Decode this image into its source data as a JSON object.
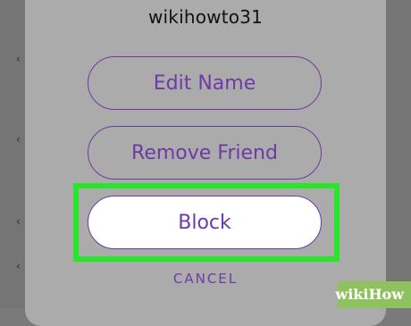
{
  "dialog": {
    "title": "wikihowto31",
    "buttons": {
      "edit_name": "Edit Name",
      "remove_friend": "Remove Friend",
      "block": "Block"
    },
    "cancel_label": "CANCEL"
  },
  "colors": {
    "accent": "#6d3aa6",
    "highlight": "#2ae62a",
    "sheet_background": "#ababab"
  },
  "watermark": {
    "logo": "wikiHow"
  }
}
